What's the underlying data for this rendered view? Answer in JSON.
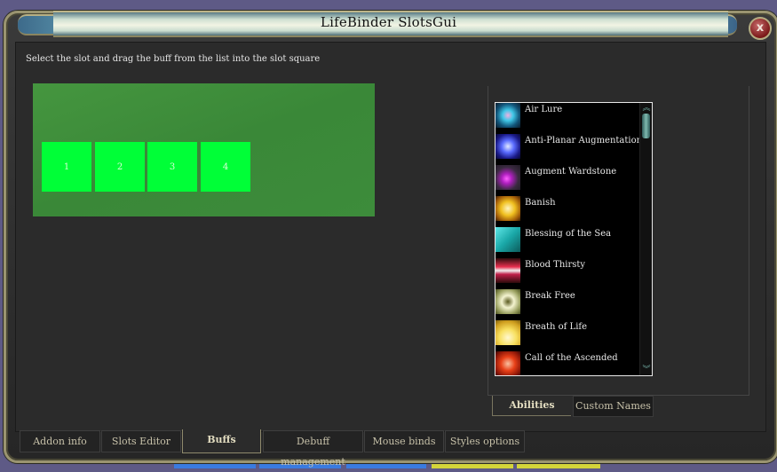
{
  "window": {
    "title": "LifeBinder SlotsGui",
    "close_label": "x"
  },
  "main": {
    "instruction": "Select the slot and drag the buff from the list into the slot square",
    "slots": [
      {
        "label": "1"
      },
      {
        "label": "2"
      },
      {
        "label": "3"
      },
      {
        "label": "4"
      }
    ],
    "slot_color": "#00ff37",
    "slot_area_color": "#3d8c3b"
  },
  "buff_list": {
    "items": [
      {
        "label": "Air Lure",
        "icon": "air-lure-icon"
      },
      {
        "label": "Anti-Planar Augmentation",
        "icon": "anti-planar-augmentation-icon"
      },
      {
        "label": "Augment Wardstone",
        "icon": "augment-wardstone-icon"
      },
      {
        "label": "Banish",
        "icon": "banish-icon"
      },
      {
        "label": "Blessing of the Sea",
        "icon": "blessing-of-the-sea-icon"
      },
      {
        "label": "Blood Thirsty",
        "icon": "blood-thirsty-icon"
      },
      {
        "label": "Break Free",
        "icon": "break-free-icon"
      },
      {
        "label": "Breath of Life",
        "icon": "breath-of-life-icon"
      },
      {
        "label": "Call of the Ascended",
        "icon": "call-of-the-ascended-icon"
      }
    ],
    "scroll_up": "︽",
    "scroll_down": "︾"
  },
  "subtabs": [
    {
      "label": "Abilities",
      "active": true
    },
    {
      "label": "Custom Names",
      "active": false
    }
  ],
  "tabs": [
    {
      "label": "Addon info",
      "active": false
    },
    {
      "label": "Slots Editor",
      "active": false
    },
    {
      "label": "Buffs",
      "active": true
    },
    {
      "label": "Debuff management",
      "active": false
    },
    {
      "label": "Mouse binds",
      "active": false
    },
    {
      "label": "Styles options",
      "active": false
    }
  ]
}
